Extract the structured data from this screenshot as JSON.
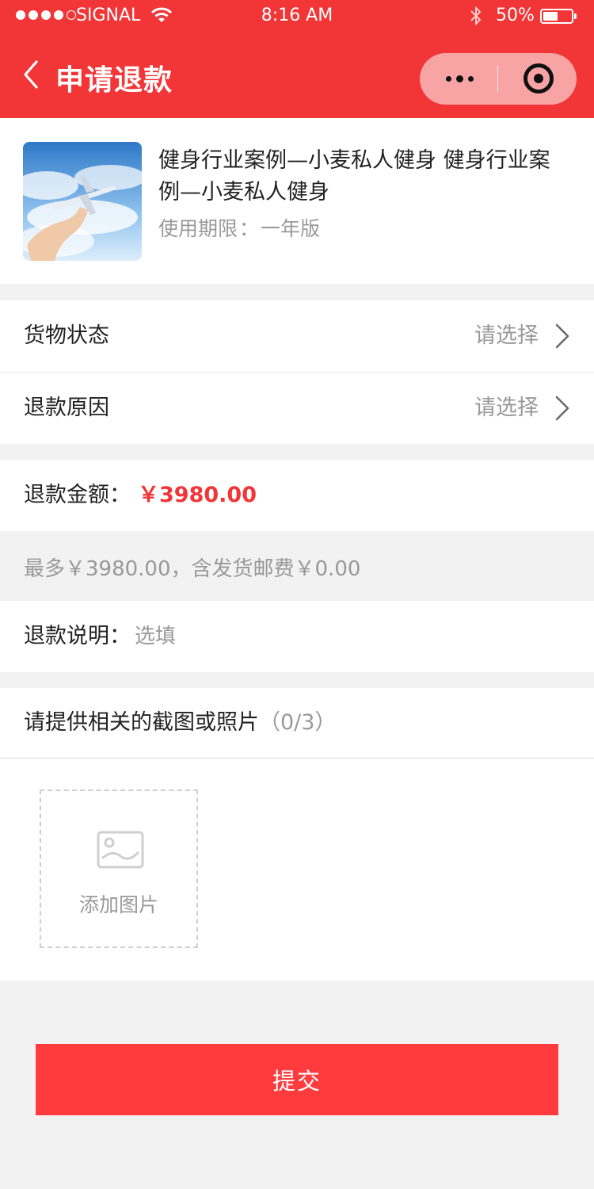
{
  "status_bar": {
    "carrier": "SIGNAL",
    "time": "8:16 AM",
    "battery": "50%"
  },
  "nav": {
    "title": "申请退款"
  },
  "product": {
    "name": "健身行业案例—小麦私人健身 健身行业案例—小麦私人健身",
    "period_label": "使用期限",
    "period_value": "一年版"
  },
  "form": {
    "goods_status": {
      "label": "货物状态",
      "value": "请选择"
    },
    "refund_reason": {
      "label": "退款原因",
      "value": "请选择"
    },
    "refund_amount": {
      "label": "退款金额：",
      "value": "￥3980.00"
    },
    "amount_hint": "最多￥3980.00，含发货邮费￥0.00",
    "refund_note": {
      "label": "退款说明：",
      "placeholder": "选填"
    },
    "photos": {
      "title": "请提供相关的截图或照片",
      "count": "（0/3）",
      "add_label": "添加图片"
    }
  },
  "submit_label": "提交",
  "colors": {
    "brand_red": "#f23537",
    "button_red": "#ff3b3d"
  },
  "icons": [
    "back-icon",
    "more-icon",
    "close-capsule-icon",
    "chevron-right-icon",
    "image-placeholder-icon",
    "wifi-icon",
    "bluetooth-icon",
    "battery-icon"
  ]
}
